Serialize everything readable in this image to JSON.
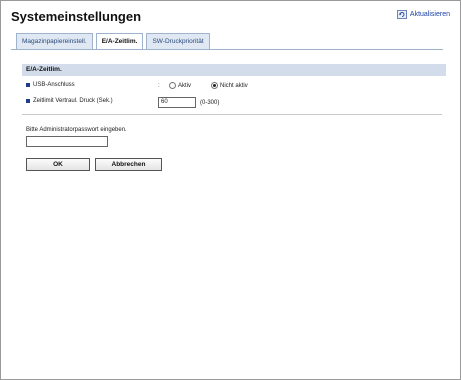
{
  "page": {
    "title": "Systemeinstellungen"
  },
  "header": {
    "refresh_label": "Aktualisieren",
    "refresh_icon": "refresh-icon"
  },
  "tabs": [
    {
      "label": "Magazinpapiereinstell.",
      "active": false
    },
    {
      "label": "E/A-Zeitlim.",
      "active": true
    },
    {
      "label": "SW-Druckpriorität",
      "active": false
    }
  ],
  "section": {
    "title": "E/A-Zeitlim."
  },
  "usb": {
    "label": "USB-Anschluss",
    "colon": ":",
    "option_on": "Aktiv",
    "option_off": "Nicht aktiv",
    "selected": "Nicht aktiv"
  },
  "timeout": {
    "label": "Zeitlimit Vertraul. Druck (Sek.)",
    "value": "60",
    "range": "(0-300)"
  },
  "password": {
    "prompt": "Bitte Administratorpasswort eingeben.",
    "value": ""
  },
  "buttons": {
    "ok": "OK",
    "cancel": "Abbrechen"
  },
  "colors": {
    "tab_bg": "#dfe8f3",
    "section_bg": "#d2dcea",
    "bullet": "#1f3d8a",
    "link": "#1a3fa8"
  }
}
